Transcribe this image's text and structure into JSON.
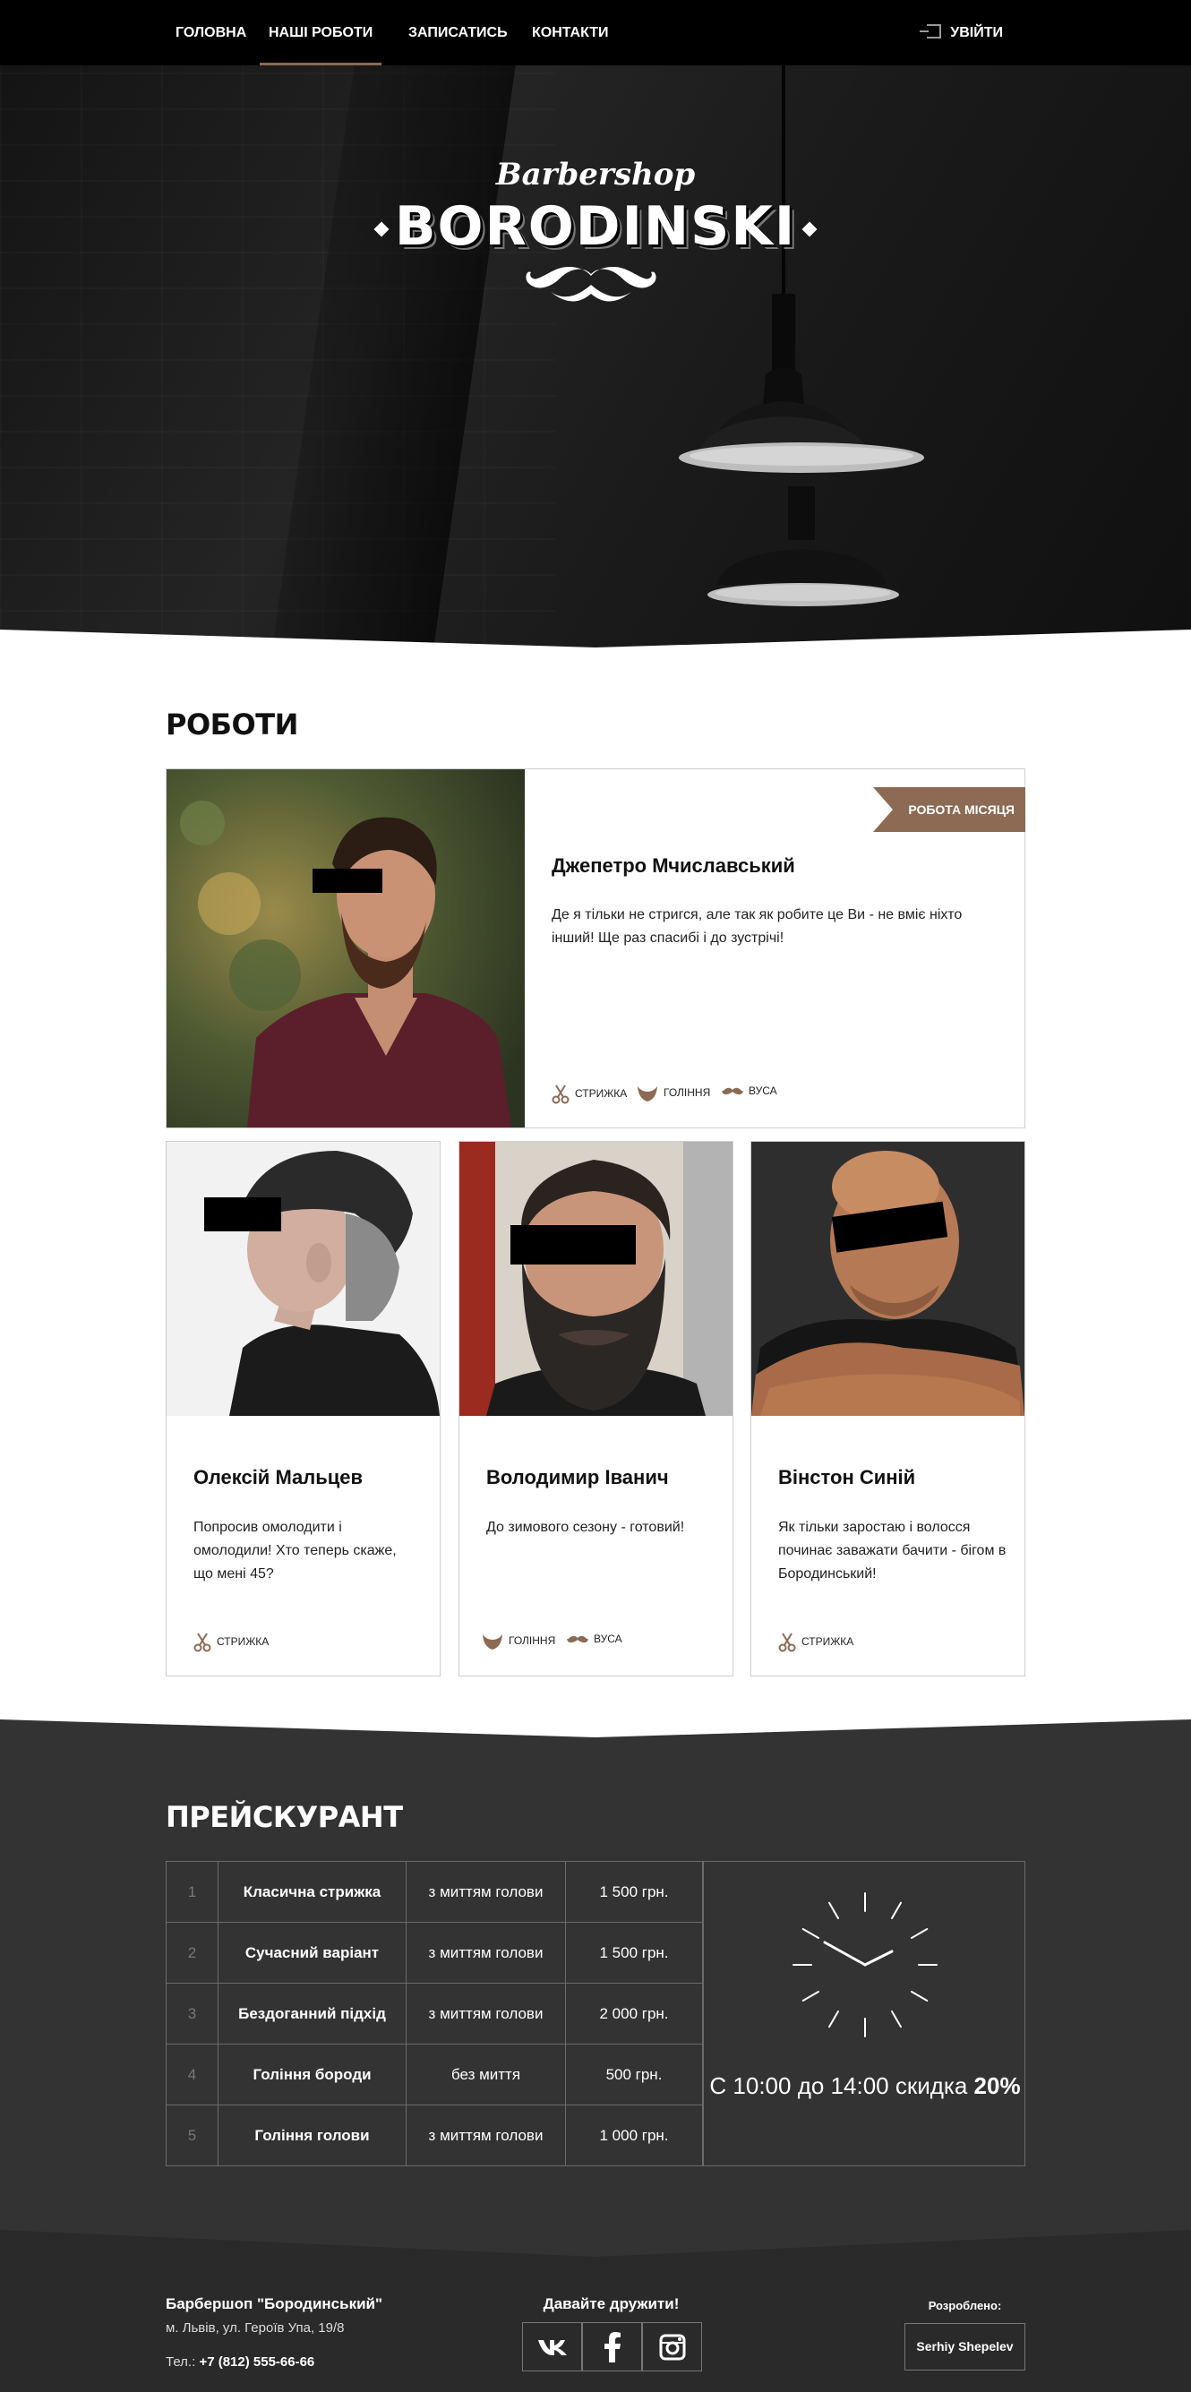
{
  "nav": {
    "items": [
      {
        "label": "ГОЛОВНА"
      },
      {
        "label": "НАШІ РОБОТИ",
        "active": true
      },
      {
        "label": "ЗАПИСАТИСЬ"
      },
      {
        "label": "КОНТАКТИ"
      }
    ],
    "login": {
      "label": "УВІЙТИ",
      "icon": "login-icon"
    }
  },
  "hero": {
    "logo_script": "Barbershop",
    "logo_main": "BORODINSKI",
    "mustache_icon": "mustache-icon"
  },
  "works": {
    "title": "РОБОТИ",
    "featured": {
      "ribbon": "РОБОТА МІСЯЦЯ",
      "name": "Джепетро Мчиславський",
      "text": "Де я тільки не стригся, але так як робите це Ви - не вміє ніхто інший! Ще раз спасибі і до зустрічі!",
      "tags": [
        {
          "label": "СТРИЖКА",
          "icon": "scissors-icon"
        },
        {
          "label": "ГОЛІННЯ",
          "icon": "beard-icon"
        },
        {
          "label": "ВУСА",
          "icon": "mustache-icon"
        }
      ]
    },
    "cards": [
      {
        "name": "Олексій Мальцев",
        "text": "Попросив омолодити і омолодили! Хто теперь скаже, що мені 45?",
        "tags": [
          {
            "label": "СТРИЖКА",
            "icon": "scissors-icon"
          }
        ]
      },
      {
        "name": "Володимир Іванич",
        "text": "До зимового сезону - готовий!",
        "tags": [
          {
            "label": "ГОЛІННЯ",
            "icon": "beard-icon"
          },
          {
            "label": "ВУСА",
            "icon": "mustache-icon"
          }
        ]
      },
      {
        "name": "Вінстон Синій",
        "text": "Як тільки заростаю і волосся починає заважати бачити - бігом в Бородинський!",
        "tags": [
          {
            "label": "СТРИЖКА",
            "icon": "scissors-icon"
          }
        ]
      }
    ]
  },
  "prices": {
    "title": "ПРЕЙСКУРАНТ",
    "rows": [
      {
        "num": "1",
        "name": "Класична стрижка",
        "desc": "з миттям голови",
        "price": "1 500 грн."
      },
      {
        "num": "2",
        "name": "Сучасний варіант",
        "desc": "з миттям голови",
        "price": "1 500 грн."
      },
      {
        "num": "3",
        "name": "Бездоганний підхід",
        "desc": "з миттям голови",
        "price": "2 000 грн."
      },
      {
        "num": "4",
        "name": "Гоління бороди",
        "desc": "без миття",
        "price": "500 грн."
      },
      {
        "num": "5",
        "name": "Гоління голови",
        "desc": "з миттям голови",
        "price": "1 000 грн."
      }
    ],
    "promo_text": "С 10:00 до 14:00 скидка",
    "promo_value": "20%",
    "clock_icon": "clock-icon"
  },
  "footer": {
    "name": "Барбершоп \"Бородинський\"",
    "address": "м. Львів, ул. Героїв Упа, 19/8",
    "phone_label": "Тел.:",
    "phone": "+7 (812) 555-66-66",
    "friends": "Давайте дружити!",
    "social": [
      {
        "label": "vk",
        "icon": "vk-icon"
      },
      {
        "label": "f",
        "icon": "facebook-icon"
      },
      {
        "label": "ig",
        "icon": "instagram-icon"
      }
    ],
    "dev_label": "Розроблено:",
    "dev_name": "Serhiy Shepelev"
  },
  "colors": {
    "accent": "#8c6a53",
    "dark": "#333333",
    "footer": "#2a2a2a",
    "nav": "#000000"
  }
}
